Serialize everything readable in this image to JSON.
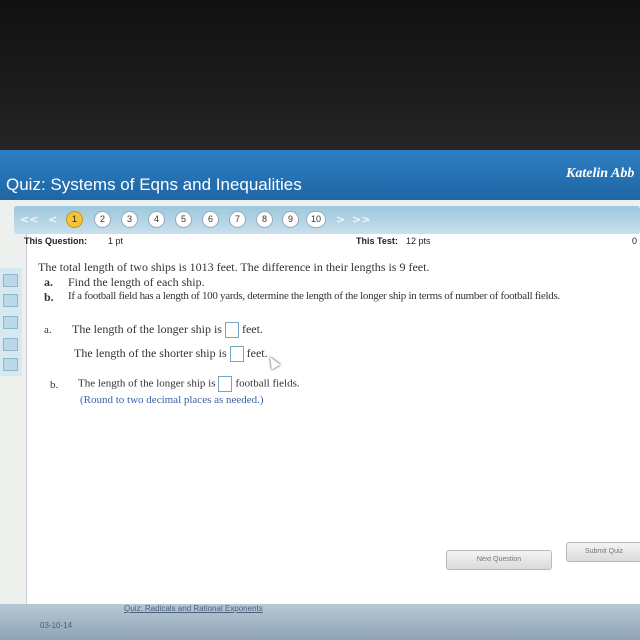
{
  "header": {
    "quiz_title": "Quiz: Systems of Eqns and Inequalities",
    "user_name": "Katelin Abb"
  },
  "nav": {
    "first": "<<",
    "prev": "<",
    "next": ">",
    "last": ">>",
    "questions": [
      "1",
      "2",
      "3",
      "4",
      "5",
      "6",
      "7",
      "8",
      "9",
      "10"
    ],
    "current": "1"
  },
  "info": {
    "this_question_label": "This Question:",
    "this_question_value": "1 pt",
    "this_test_label": "This Test:",
    "this_test_value": "12 pts",
    "right_value": "0"
  },
  "question": {
    "stem": "The total length of two ships is 1013 feet. The difference in their lengths is 9 feet.",
    "part_a_label": "a.",
    "part_a_text": "Find the length of each ship.",
    "part_b_label": "b.",
    "part_b_text": "If a football field has a length of 100 yards, determine the length of the longer ship in terms of number of football fields."
  },
  "answers": {
    "a_label": "a.",
    "a1_prefix": "The length of the longer ship is",
    "a1_value": "",
    "a1_unit": "feet.",
    "a2_prefix": "The length of the shorter ship is",
    "a2_value": "",
    "a2_unit": "feet.",
    "b_label": "b.",
    "b_prefix": "The length of the longer ship is",
    "b_value": "",
    "b_unit": "football fields.",
    "b_hint": "(Round to two decimal places as needed.)"
  },
  "buttons": {
    "next": "Next Question",
    "submit": "Submit Quiz"
  },
  "bottom": {
    "date": "03-10-14",
    "link": "Quiz: Radicals and Rational Exponents"
  }
}
